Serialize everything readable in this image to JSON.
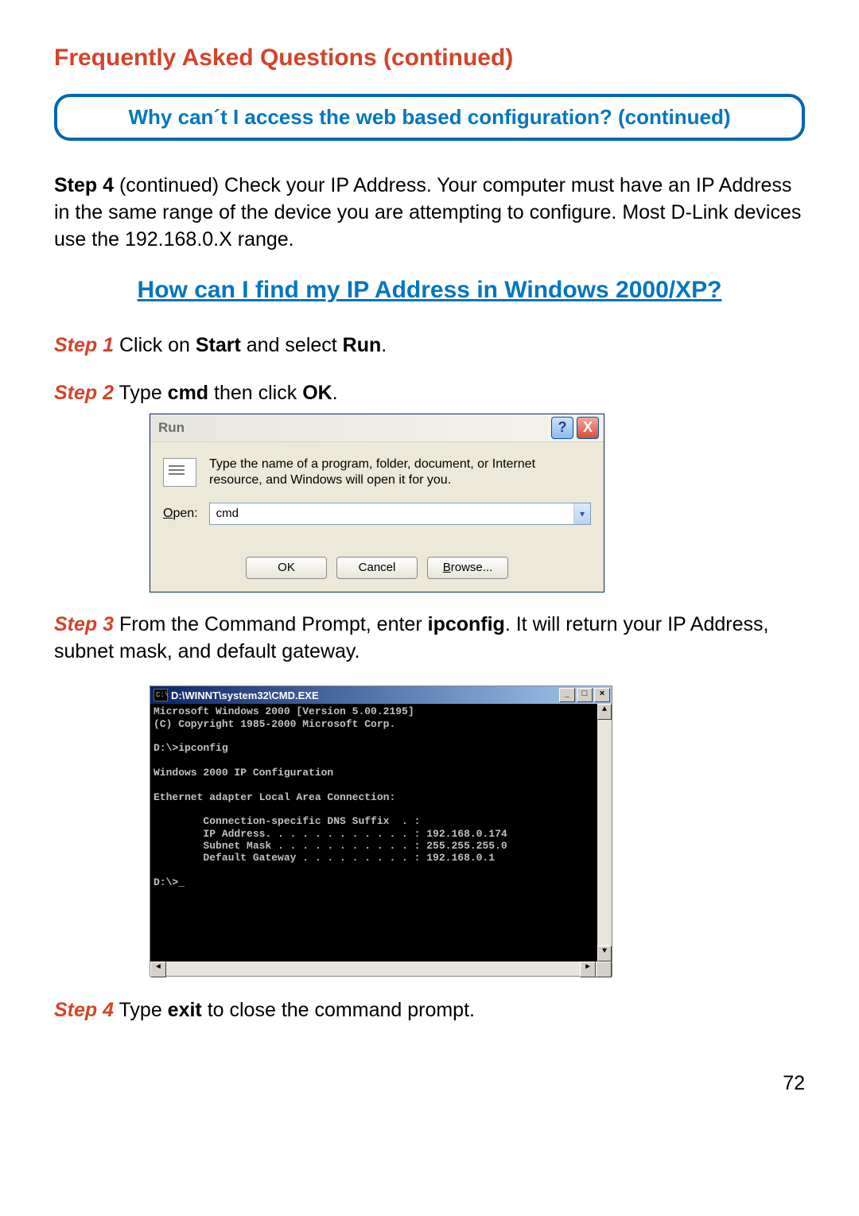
{
  "faq_title": "Frequently Asked Questions (continued)",
  "question_box": "Why can´t I access the web based configuration? (continued)",
  "step4_top": {
    "label": "Step 4",
    "cont": " (continued)",
    "text": " Check your IP Address. Your computer must have an IP Address in the same range of the device you are attempting to configure. Most D-Link devices use the 192.168.0.X range."
  },
  "section_title": "How can I find my IP Address in Windows 2000/XP?",
  "step1": {
    "label": "Step 1",
    "pre": " Click on ",
    "b1": "Start",
    "mid": " and select ",
    "b2": "Run",
    "post": "."
  },
  "step2": {
    "label": "Step 2",
    "pre": " Type ",
    "b1": "cmd",
    "mid": " then click ",
    "b2": "OK",
    "post": "."
  },
  "run_dialog": {
    "title": "Run",
    "help": "?",
    "close": "X",
    "description": "Type the name of a program, folder, document, or Internet resource, and Windows will open it for you.",
    "open_label_u": "O",
    "open_label_rest": "pen:",
    "value": "cmd",
    "ok": "OK",
    "cancel": "Cancel",
    "browse_u": "B",
    "browse_rest": "rowse..."
  },
  "step3": {
    "label": "Step 3",
    "pre": " From the Command Prompt, enter ",
    "b1": "ipconfig",
    "post": ". It will return your IP Address, subnet mask, and default gateway."
  },
  "cmd": {
    "icon": "C:\\",
    "title": "D:\\WINNT\\system32\\CMD.EXE",
    "min": "_",
    "max": "□",
    "close": "×",
    "up": "▲",
    "down": "▼",
    "left": "◄",
    "right": "►",
    "content": "Microsoft Windows 2000 [Version 5.00.2195]\n(C) Copyright 1985-2000 Microsoft Corp.\n\nD:\\>ipconfig\n\nWindows 2000 IP Configuration\n\nEthernet adapter Local Area Connection:\n\n        Connection-specific DNS Suffix  . :\n        IP Address. . . . . . . . . . . . : 192.168.0.174\n        Subnet Mask . . . . . . . . . . . : 255.255.255.0\n        Default Gateway . . . . . . . . . : 192.168.0.1\n\nD:\\>_"
  },
  "step4": {
    "label": "Step 4",
    "pre": " Type ",
    "b1": "exit",
    "post": " to close the command prompt."
  },
  "page_number": "72"
}
